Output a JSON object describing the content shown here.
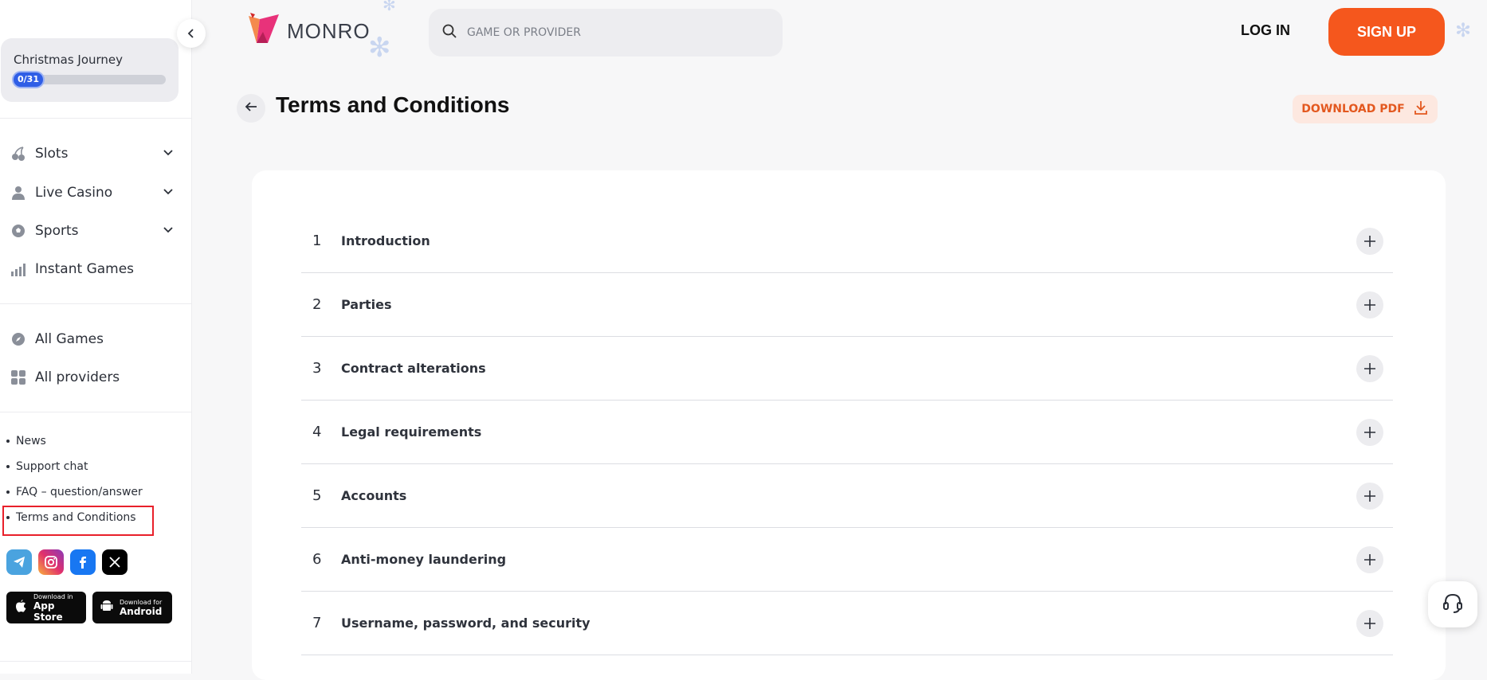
{
  "sidebar": {
    "journey": {
      "title": "Christmas Journey",
      "progress": "0/31",
      "progress_fraction": 0
    },
    "nav": [
      {
        "label": "Slots"
      },
      {
        "label": "Live Casino"
      },
      {
        "label": "Sports"
      },
      {
        "label": "Instant Games"
      }
    ],
    "games": [
      {
        "label": "All Games"
      },
      {
        "label": "All providers"
      }
    ],
    "links": [
      {
        "label": "News"
      },
      {
        "label": "Support chat"
      },
      {
        "label": "FAQ – question/answer"
      },
      {
        "label": "Terms and Conditions"
      }
    ],
    "stores": {
      "apple": {
        "small": "Download in",
        "big": "App Store"
      },
      "android": {
        "small": "Download for",
        "big": "Android"
      }
    }
  },
  "header": {
    "logo": "MONRO",
    "search_placeholder": "GAME OR PROVIDER",
    "login": "LOG IN",
    "signup": "SIGN UP"
  },
  "page": {
    "title": "Terms and Conditions",
    "download": "DOWNLOAD PDF",
    "sections": [
      {
        "num": "1",
        "label": "Introduction"
      },
      {
        "num": "2",
        "label": "Parties"
      },
      {
        "num": "3",
        "label": "Contract alterations"
      },
      {
        "num": "4",
        "label": "Legal requirements"
      },
      {
        "num": "5",
        "label": "Accounts"
      },
      {
        "num": "6",
        "label": "Anti-money laundering"
      },
      {
        "num": "7",
        "label": "Username, password, and security"
      }
    ]
  },
  "colors": {
    "accent": "#f5571d",
    "progress": "#2f5ee6",
    "highlight": "#e8202a"
  }
}
